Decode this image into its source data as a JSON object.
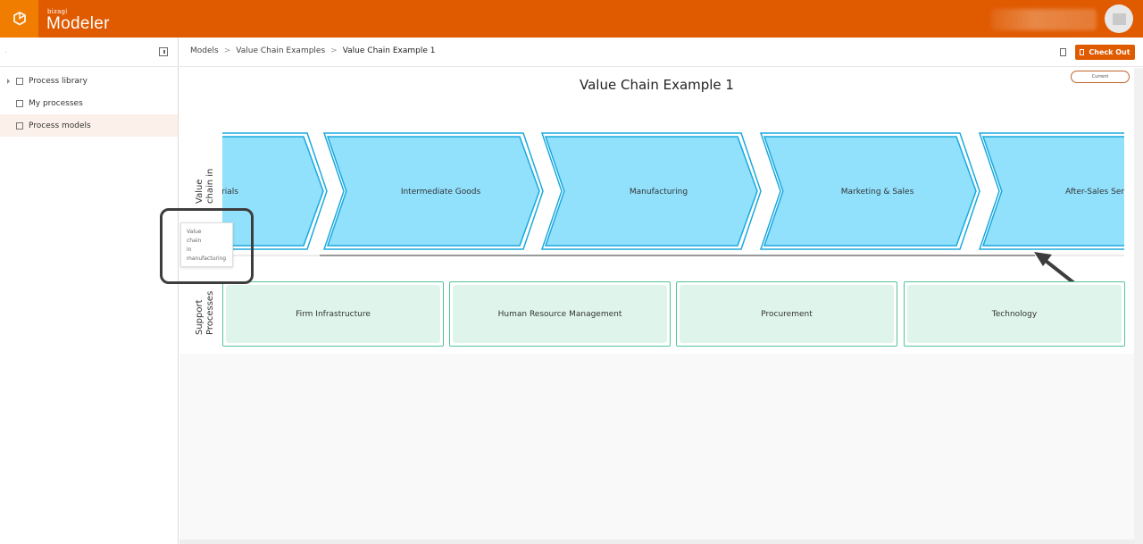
{
  "app": {
    "brand_small": "bizagi",
    "brand_name": "Modeler",
    "logo_icon": "box-icon",
    "user_avatar_icon": "user-avatar-icon"
  },
  "sidebar": {
    "collapse_icon": "collapse-panel-icon",
    "items": [
      {
        "label": "Process library",
        "icon": "library-icon",
        "expandable": true,
        "active": false
      },
      {
        "label": "My processes",
        "icon": "clipboard-icon",
        "expandable": false,
        "active": false
      },
      {
        "label": "Process models",
        "icon": "edit-model-icon",
        "expandable": false,
        "active": true
      }
    ]
  },
  "breadcrumb": {
    "items": [
      "Models",
      "Value Chain Examples",
      "Value Chain Example 1"
    ],
    "separator": ">"
  },
  "toolbar": {
    "document_icon": "document-icon",
    "checkout_label": "Check Out",
    "checkout_color": "#e05a00"
  },
  "diagram": {
    "title": "Value Chain Example 1",
    "version_badge": "Current",
    "primary_lane_label_line1": "Value",
    "primary_lane_label_line2": "chain in",
    "support_lane_label_line1": "Support",
    "support_lane_label_line2": "Processes",
    "primary_activities": [
      "rials",
      "Intermediate Goods",
      "Manufacturing",
      "Marketing & Sales",
      "After-Sales Serv"
    ],
    "support_activities": [
      "Firm Infrastructure",
      "Human Resource Management",
      "Procurement",
      "Technology"
    ],
    "tooltip_lines": [
      "Value",
      "chain",
      "in",
      "manufacturing"
    ],
    "colors": {
      "chevron_fill": "#91e0fc",
      "chevron_stroke": "#1aa9de",
      "support_fill": "#dff5eb",
      "support_stroke": "#52c49a",
      "accent": "#e05a00"
    }
  }
}
